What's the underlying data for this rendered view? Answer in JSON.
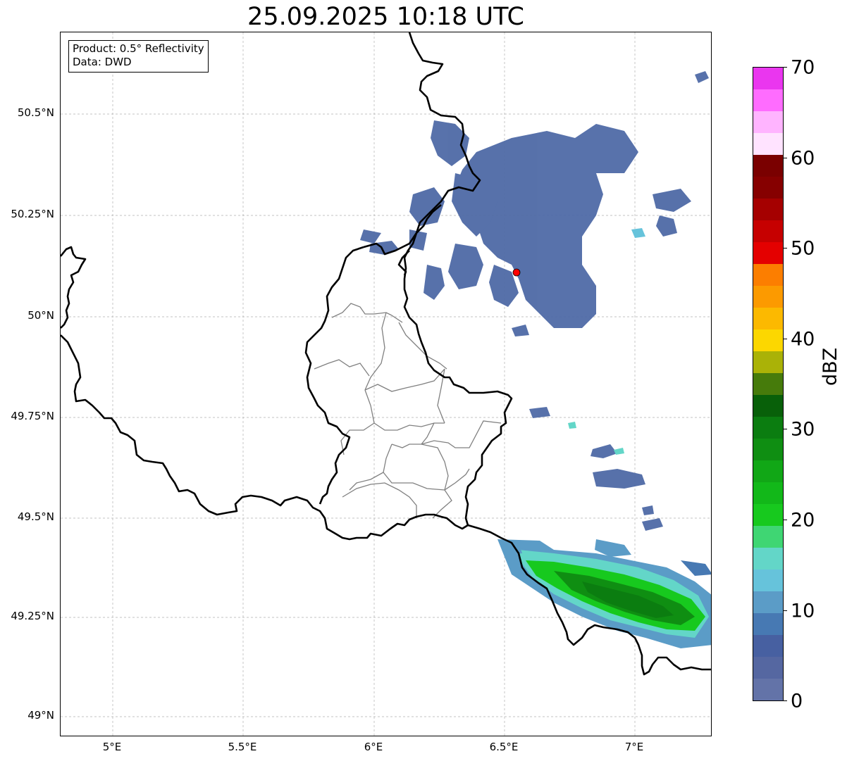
{
  "title": "25.09.2025 10:18 UTC",
  "info": {
    "product": "Product: 0.5° Reflectivity",
    "data": "Data: DWD"
  },
  "lat_ticks": [
    "50.5°N",
    "50.25°N",
    "50°N",
    "49.75°N",
    "49.5°N",
    "49.25°N",
    "49°N"
  ],
  "lon_ticks": [
    "5°E",
    "5.5°E",
    "6°E",
    "6.5°E",
    "7°E"
  ],
  "colorbar": {
    "unit": "dBZ",
    "tick_labels": [
      "0",
      "10",
      "20",
      "30",
      "40",
      "50",
      "60",
      "70"
    ],
    "colors": [
      "#6373a8",
      "#5567a1",
      "#4760a1",
      "#4779b3",
      "#5b9cc7",
      "#66c3db",
      "#63d6c8",
      "#3fd673",
      "#17c91e",
      "#12b819",
      "#11a716",
      "#0f8e12",
      "#0b7d10",
      "#086009",
      "#467b0b",
      "#aab207",
      "#fcd700",
      "#fcb900",
      "#fc9a00",
      "#fc7e00",
      "#e40000",
      "#c60000",
      "#a50000",
      "#860000",
      "#7a0000",
      "#ffe3ff",
      "#ffb4ff",
      "#ff6cff",
      "#ea36ef"
    ]
  },
  "radar_site": {
    "name": "radar-site",
    "color": "#ff0000"
  }
}
